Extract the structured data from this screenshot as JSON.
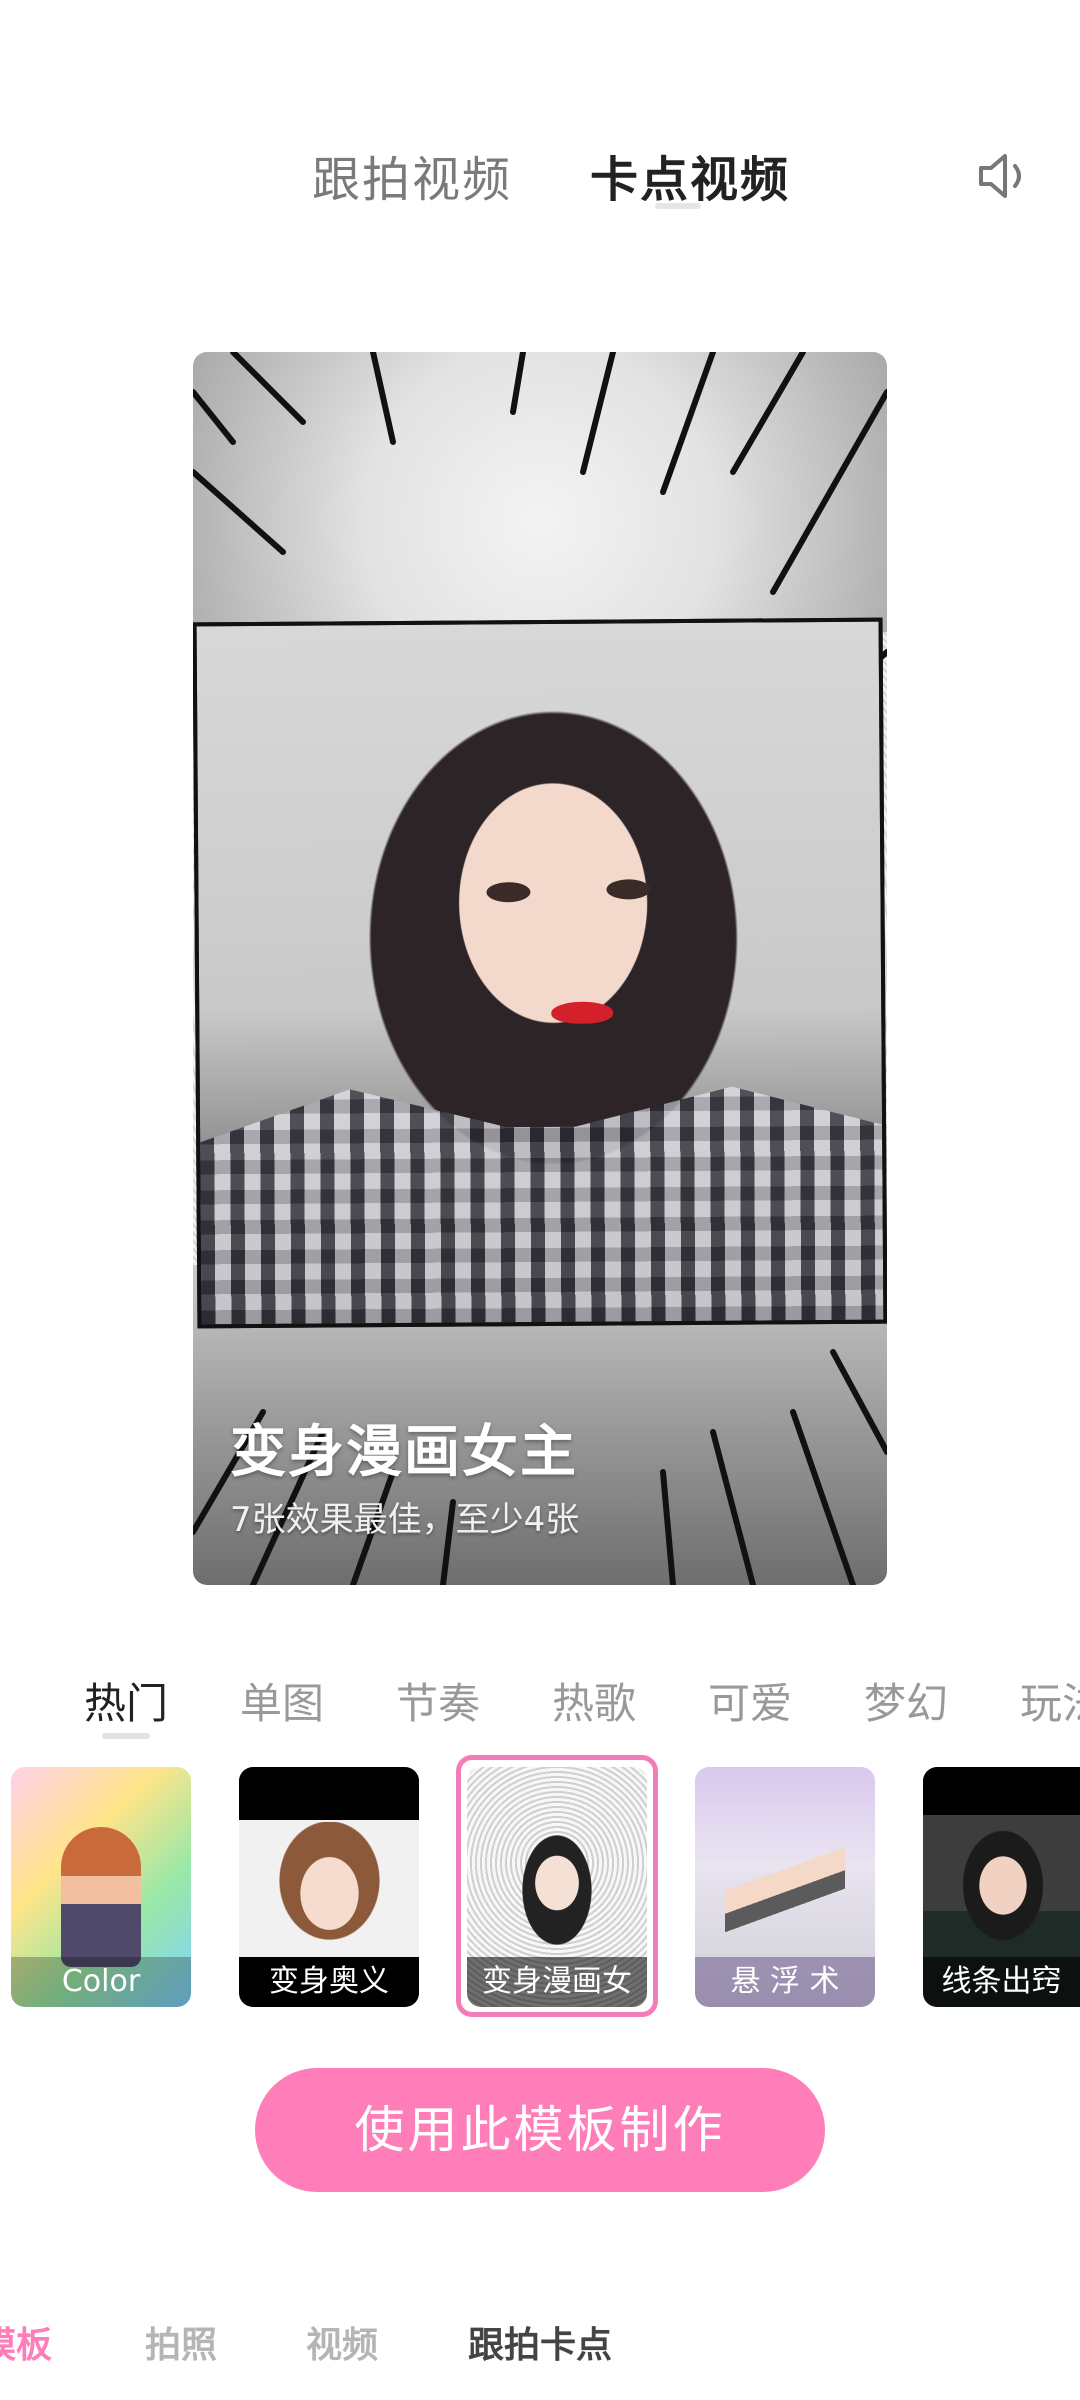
{
  "top_tabs": [
    {
      "label": "跟拍视频",
      "active": false
    },
    {
      "label": "卡点视频",
      "active": true
    }
  ],
  "sound_icon": "speaker-icon",
  "preview": {
    "title": "变身漫画女主",
    "subtitle": "7张效果最佳，至少4张"
  },
  "categories": [
    "热门",
    "单图",
    "节奏",
    "热歌",
    "可爱",
    "梦幻",
    "玩法"
  ],
  "active_category": "热门",
  "thumbnails": [
    {
      "label": "Color"
    },
    {
      "label": "变身奥义"
    },
    {
      "label": "变身漫画女"
    },
    {
      "label": "悬 浮 术"
    },
    {
      "label": "线条出窍"
    }
  ],
  "selected_thumbnail": "变身漫画女",
  "cta_label": "使用此模板制作",
  "bottom_nav": [
    {
      "label": "模板",
      "active": true
    },
    {
      "label": "拍照",
      "active": false
    },
    {
      "label": "视频",
      "active": false
    },
    {
      "label": "跟拍卡点",
      "active": false
    }
  ],
  "colors": {
    "accent": "#ff7db9",
    "selected_ring": "#f47cb8"
  }
}
